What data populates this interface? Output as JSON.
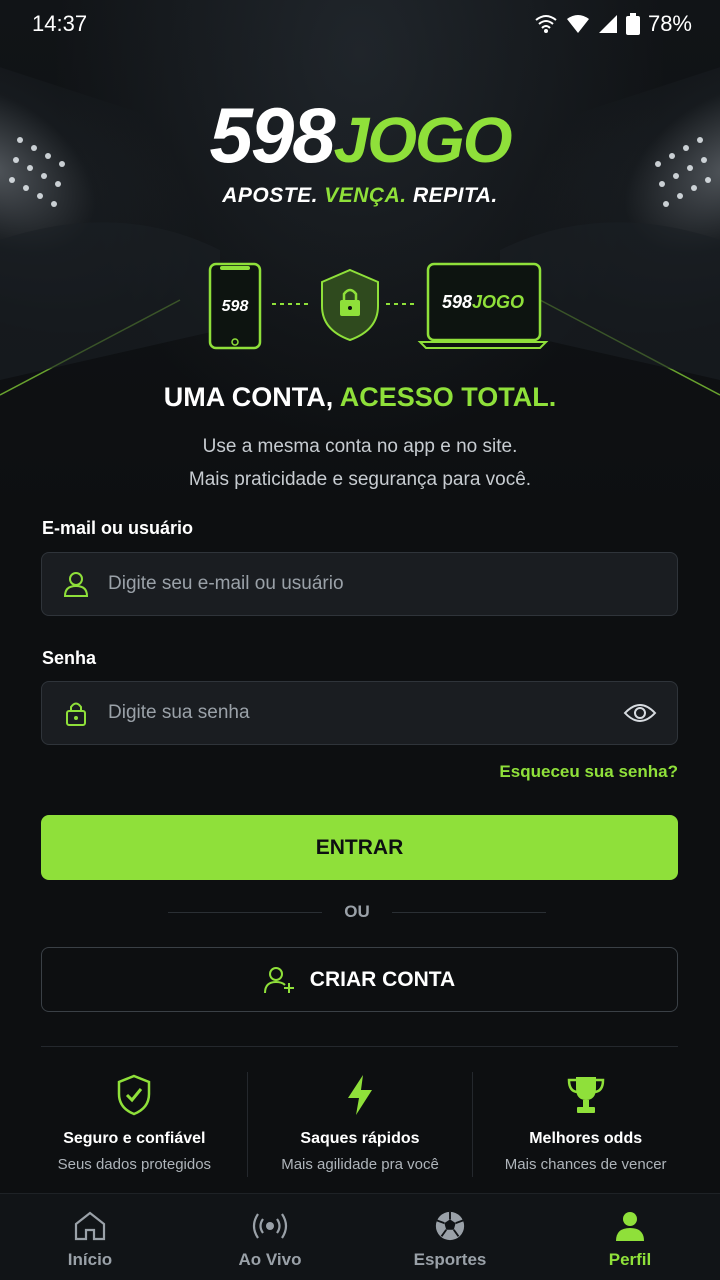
{
  "status_bar": {
    "time": "14:37",
    "battery": "78%"
  },
  "brand": {
    "number": "598",
    "word": "JOGO",
    "tagline_part1": "APOSTE.",
    "tagline_part2": "VENÇA.",
    "tagline_part3": "REPITA."
  },
  "devices": {
    "phone_text": "598",
    "laptop_number": "598",
    "laptop_word": "JOGO"
  },
  "headline": {
    "part1": "UMA CONTA,",
    "part2": "ACESSO TOTAL."
  },
  "subtext": {
    "line1": "Use a mesma conta no app e no site.",
    "line2": "Mais praticidade e segurança para você."
  },
  "login": {
    "email_label": "E-mail ou usuário",
    "email_placeholder": "Digite seu e-mail ou usuário",
    "password_label": "Senha",
    "password_placeholder": "Digite sua senha",
    "forgot": "Esqueceu sua senha?",
    "enter_button": "ENTRAR",
    "or_text": "OU",
    "create_button": "CRIAR CONTA"
  },
  "features": [
    {
      "icon": "shield-check-icon",
      "title": "Seguro e confiável",
      "subtitle": "Seus dados protegidos"
    },
    {
      "icon": "lightning-icon",
      "title": "Saques rápidos",
      "subtitle": "Mais agilidade pra você"
    },
    {
      "icon": "trophy-icon",
      "title": "Melhores odds",
      "subtitle": "Mais chances de vencer"
    }
  ],
  "nav": [
    {
      "icon": "home-icon",
      "label": "Início",
      "active": false
    },
    {
      "icon": "live-icon",
      "label": "Ao Vivo",
      "active": false
    },
    {
      "icon": "soccer-ball-icon",
      "label": "Esportes",
      "active": false
    },
    {
      "icon": "profile-icon",
      "label": "Perfil",
      "active": true
    }
  ],
  "colors": {
    "accent": "#8fe03a",
    "background": "#0d0f11",
    "input_bg": "#1a1d21"
  }
}
